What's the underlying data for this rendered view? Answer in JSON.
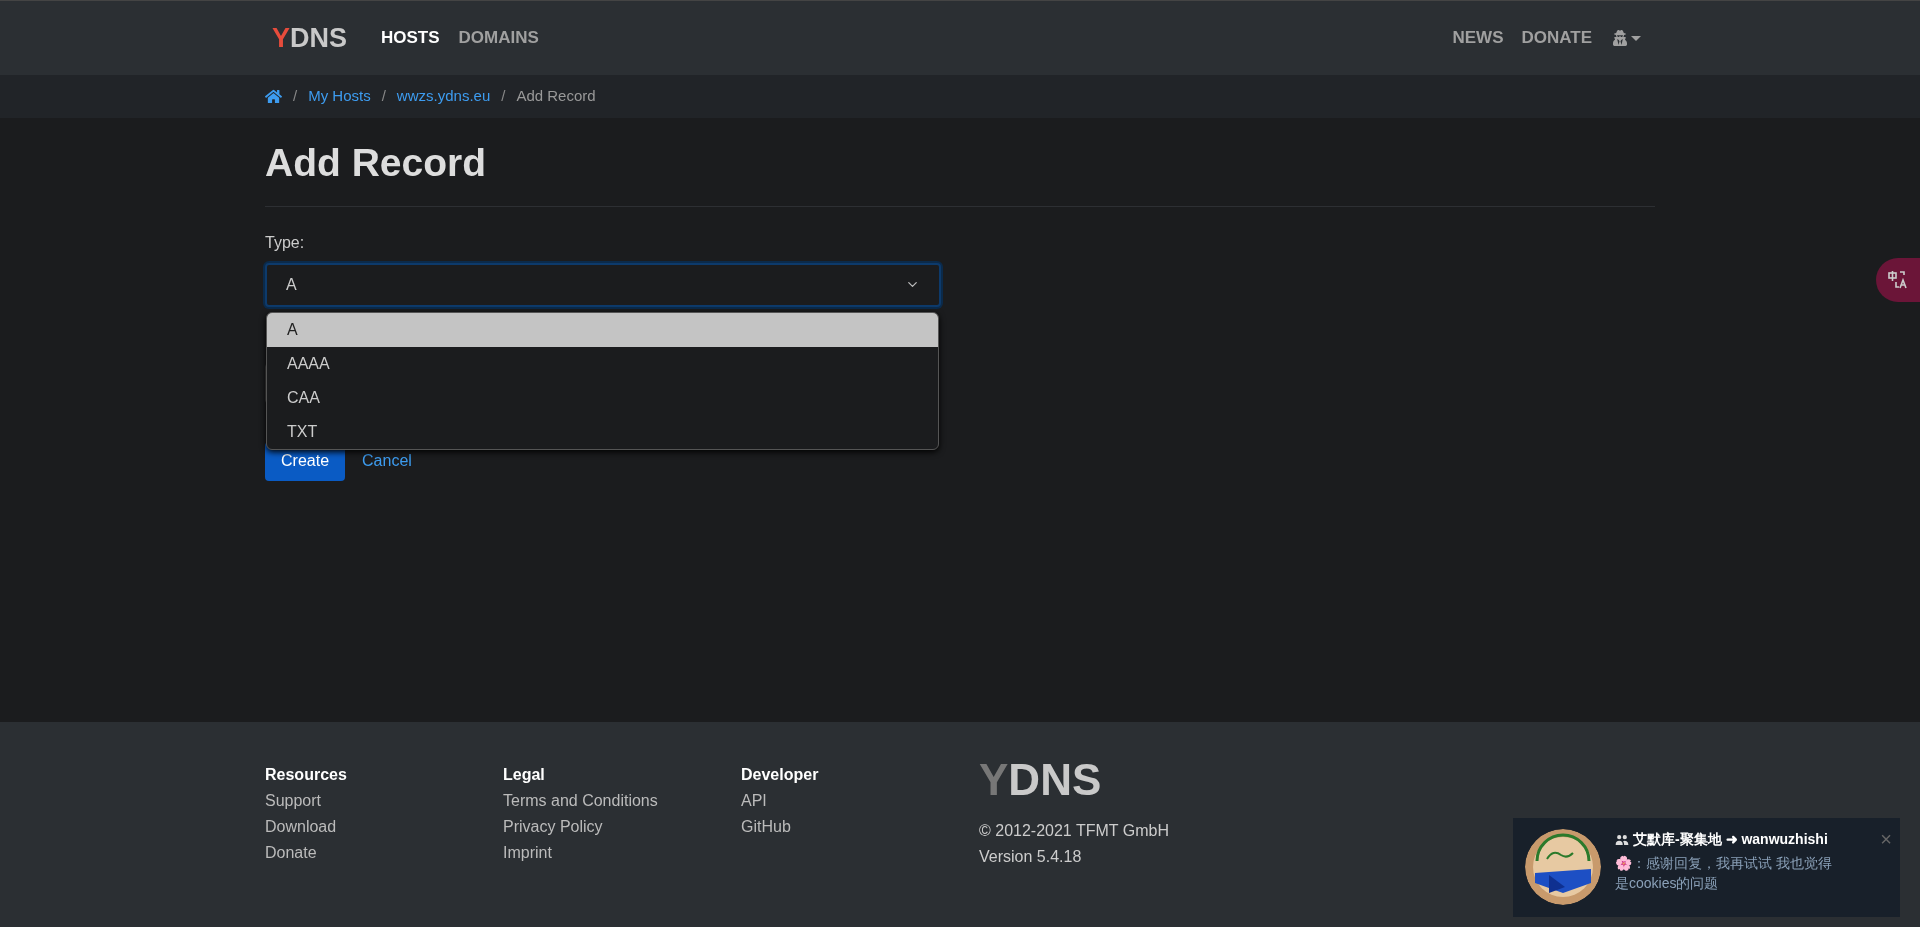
{
  "navbar": {
    "logo_first": "Y",
    "logo_rest": "DNS",
    "items": [
      {
        "label": "HOSTS",
        "selected": true
      },
      {
        "label": "DOMAINS",
        "selected": false
      }
    ],
    "right_items": [
      {
        "label": "NEWS"
      },
      {
        "label": "DONATE"
      }
    ]
  },
  "breadcrumb": {
    "items": [
      {
        "label": "My Hosts"
      },
      {
        "label": "wwzs.ydns.eu"
      }
    ],
    "current": "Add Record",
    "separator": "/"
  },
  "page": {
    "title": "Add Record",
    "type_label": "Type:",
    "select_value": "A",
    "options": [
      {
        "label": "A",
        "selected": true
      },
      {
        "label": "AAAA",
        "selected": false
      },
      {
        "label": "CAA",
        "selected": false
      },
      {
        "label": "TXT",
        "selected": false
      }
    ],
    "buttons": {
      "create": "Create",
      "cancel": "Cancel"
    }
  },
  "footer": {
    "columns": [
      {
        "heading": "Resources",
        "links": [
          "Support",
          "Download",
          "Donate"
        ]
      },
      {
        "heading": "Legal",
        "links": [
          "Terms and Conditions",
          "Privacy Policy",
          "Imprint"
        ]
      },
      {
        "heading": "Developer",
        "links": [
          "API",
          "GitHub"
        ]
      }
    ],
    "logo_first": "Y",
    "logo_rest": "DNS",
    "copyright": "© 2012-2021 TFMT GmbH",
    "version": "Version 5.4.18"
  },
  "notification": {
    "title": "艾默库-聚集地 ➜ wanwuzhishi",
    "emoji": "🌸",
    "message": "：感谢回复，我再试试 我也觉得是cookies的问题",
    "close": "×"
  }
}
